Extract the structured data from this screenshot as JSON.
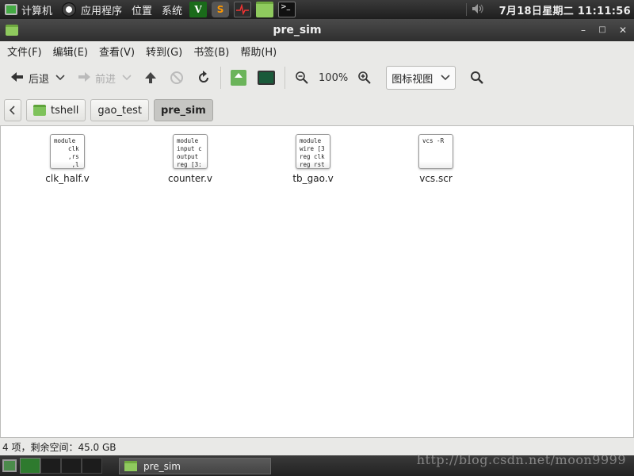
{
  "top_panel": {
    "computer_label": "计算机",
    "apps_menu": "应用程序",
    "places_menu": "位置",
    "system_menu": "系统",
    "vim_glyph": "V",
    "sublime_glyph": "S",
    "term_glyph": ">_",
    "clock": "7月18日星期二 11:11:56"
  },
  "window": {
    "title": "pre_sim",
    "minimize": "–",
    "maximize": "□",
    "close": "✕"
  },
  "menubar": {
    "items": [
      "文件(F)",
      "编辑(E)",
      "查看(V)",
      "转到(G)",
      "书签(B)",
      "帮助(H)"
    ]
  },
  "toolbar": {
    "back_label": "后退",
    "forward_label": "前进",
    "zoom_level": "100%",
    "view_mode": "图标视图"
  },
  "pathbar": {
    "crumbs": [
      "tshell",
      "gao_test",
      "pre_sim"
    ],
    "active": "pre_sim"
  },
  "files": [
    {
      "name": "clk_half.v",
      "preview": "module\n    clk\n    ,rs\n     ,l"
    },
    {
      "name": "counter.v",
      "preview": "module\ninput c\noutput\nreg [3:"
    },
    {
      "name": "tb_gao.v",
      "preview": "module\nwire [3\nreg clk\nreg rst"
    },
    {
      "name": "vcs.scr",
      "preview": "vcs -R"
    }
  ],
  "statusbar": {
    "text": "4 项，剩余空间：45.0 GB"
  },
  "bottom_panel": {
    "task_label": "pre_sim"
  },
  "watermark": "http://blog.csdn.net/moon9999"
}
